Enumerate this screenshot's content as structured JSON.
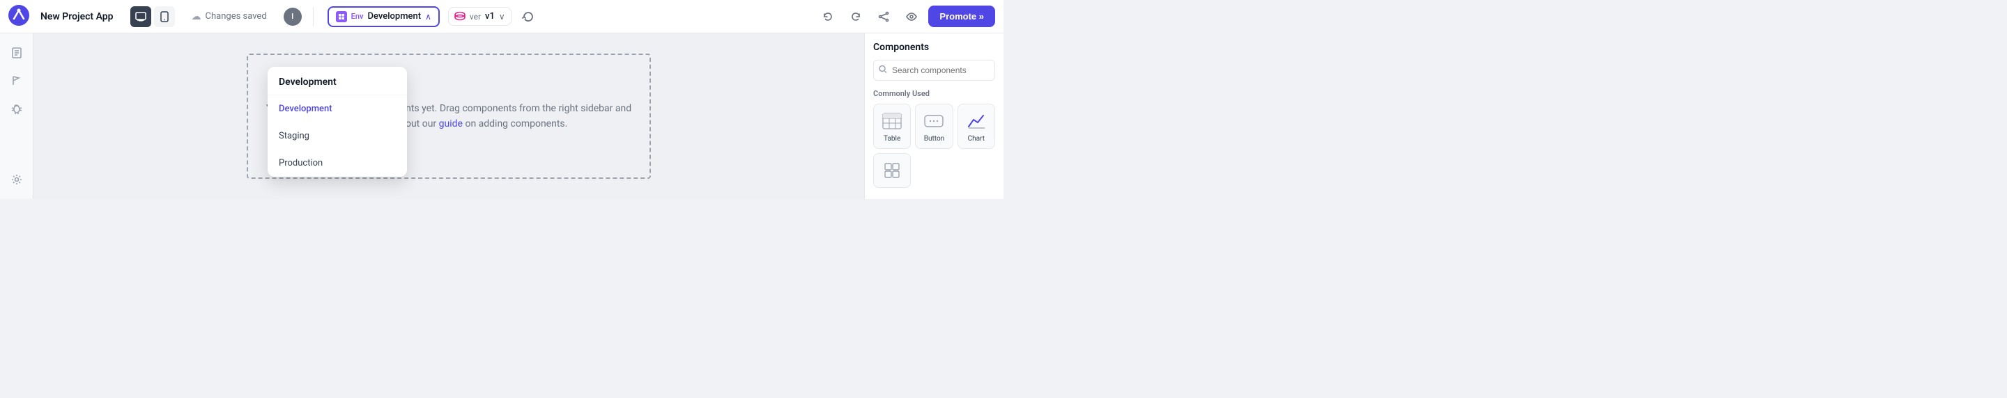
{
  "app": {
    "title": "New Project App",
    "logo_color": "#4f46e5"
  },
  "header": {
    "view_desktop_label": "🖥",
    "view_mobile_label": "📱",
    "changes_saved": "Changes saved",
    "user_initial": "I",
    "env_label": "Env",
    "env_value": "Development",
    "ver_label": "ver",
    "ver_value": "v1",
    "promote_label": "Promote »",
    "chevron_down": "∨"
  },
  "dropdown": {
    "header": "Development",
    "items": [
      {
        "label": "Development",
        "active": true
      },
      {
        "label": "Staging",
        "active": false
      },
      {
        "label": "Production",
        "active": false
      }
    ]
  },
  "canvas": {
    "empty_text": "You haven't added any components yet. Drag components from the right sidebar and drop here. Check out our",
    "link_text": "guide",
    "empty_text2": "on adding components."
  },
  "sidebar_icons": [
    {
      "name": "pages-icon",
      "glyph": "☰"
    },
    {
      "name": "flag-icon",
      "glyph": "⚑"
    },
    {
      "name": "bug-icon",
      "glyph": "🐛"
    },
    {
      "name": "settings-icon",
      "glyph": "⚙"
    }
  ],
  "components_panel": {
    "title": "Components",
    "search_placeholder": "Search components",
    "commonly_used_label": "Commonly Used",
    "items": [
      {
        "name": "Table",
        "icon_type": "table"
      },
      {
        "name": "Button",
        "icon_type": "button"
      },
      {
        "name": "Chart",
        "icon_type": "chart"
      }
    ]
  }
}
